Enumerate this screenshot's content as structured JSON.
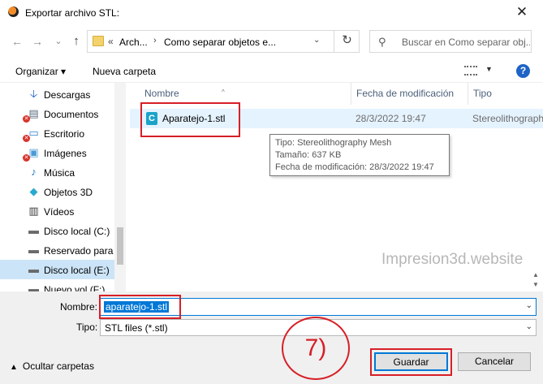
{
  "window": {
    "title": "Exportar archivo STL:",
    "close_glyph": "✕"
  },
  "nav": {
    "back_glyph": "←",
    "forward_glyph": "→",
    "recent_glyph": "⌄",
    "up_glyph": "↑",
    "breadcrumb_prefix": "«",
    "breadcrumbs": [
      "Arch...",
      "Como separar objetos e..."
    ],
    "refresh_glyph": "↻",
    "search_placeholder": "Buscar en Como separar obj..."
  },
  "toolbar": {
    "organize": "Organizar ▾",
    "new_folder": "Nueva carpeta"
  },
  "sidebar": {
    "items": [
      {
        "label": "Descargas",
        "icon": "download-icon",
        "glyph": "🡣",
        "color": "#1e63c6",
        "error": false
      },
      {
        "label": "Documentos",
        "icon": "documents-icon",
        "glyph": "▤",
        "color": "#5a6b7d",
        "error": true
      },
      {
        "label": "Escritorio",
        "icon": "desktop-icon",
        "glyph": "▭",
        "color": "#2c7fd0",
        "error": true
      },
      {
        "label": "Imágenes",
        "icon": "pictures-icon",
        "glyph": "▣",
        "color": "#4a9bd5",
        "error": true
      },
      {
        "label": "Música",
        "icon": "music-icon",
        "glyph": "♪",
        "color": "#1e7ac4",
        "error": false
      },
      {
        "label": "Objetos 3D",
        "icon": "objects-3d-icon",
        "glyph": "◆",
        "color": "#2aa9cf",
        "error": false
      },
      {
        "label": "Vídeos",
        "icon": "videos-icon",
        "glyph": "▥",
        "color": "#3b3b3b",
        "error": false
      },
      {
        "label": "Disco local (C:)",
        "icon": "drive-c-icon",
        "glyph": "▬",
        "color": "#6a6a6a",
        "error": false
      },
      {
        "label": "Reservado para el",
        "icon": "drive-reserved-icon",
        "glyph": "▬",
        "color": "#6a6a6a",
        "error": false
      },
      {
        "label": "Disco local (E:)",
        "icon": "drive-e-icon",
        "glyph": "▬",
        "color": "#6a6a6a",
        "error": false
      },
      {
        "label": "Nuevo vol (F:)",
        "icon": "drive-f-icon",
        "glyph": "▬",
        "color": "#6a6a6a",
        "error": false
      }
    ],
    "selected_index": 9,
    "error_glyph": "✕"
  },
  "filelist": {
    "columns": {
      "name": "Nombre",
      "date": "Fecha de modificación",
      "type": "Tipo"
    },
    "sort_glyph": "^",
    "file": {
      "name": "Aparatejo-1.stl",
      "date": "28/3/2022 19:47",
      "type": "Stereolithography",
      "icon_glyph": "C"
    },
    "tooltip": {
      "type_line": "Tipo: Stereolithography Mesh",
      "size_line": "Tamaño: 637 KB",
      "date_line": "Fecha de modificación: 28/3/2022 19:47"
    },
    "watermark": "Impresion3d.website",
    "scroll_up_glyph": "▲",
    "scroll_down_glyph": "▼"
  },
  "bottom": {
    "name_label": "Nombre:",
    "name_value": "aparatejo-1.stl",
    "type_label": "Tipo:",
    "type_value": "STL files (*.stl)",
    "dropdown_glyph": "⌄",
    "step_label": "7)",
    "hide_folders": "Ocultar carpetas",
    "hide_glyph": "▲",
    "save": "Guardar",
    "cancel": "Cancelar"
  },
  "colors": {
    "highlight_red": "#d71f27",
    "selection_blue": "#0078d7",
    "row_hover": "#e5f3ff"
  }
}
